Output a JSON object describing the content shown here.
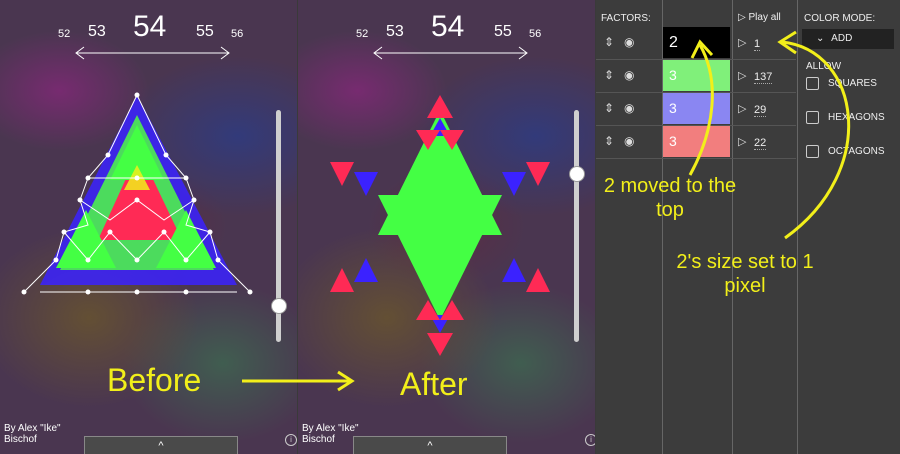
{
  "before_panel": {
    "numbers": {
      "n52": "52",
      "n53": "53",
      "n54": "54",
      "n55": "55",
      "n56": "56"
    },
    "credit": "By Alex \"Ike\" Bischof",
    "tab_icon": "^",
    "info_icon": "i",
    "slider_value": 0.16
  },
  "after_panel": {
    "numbers": {
      "n52": "52",
      "n53": "53",
      "n54": "54",
      "n55": "55",
      "n56": "56"
    },
    "credit": "By Alex \"Ike\" Bischof",
    "tab_icon": "^",
    "info_icon": "i",
    "slider_value": 0.73
  },
  "labels": {
    "before": "Before",
    "after": "After"
  },
  "annotations": {
    "moved": "2 moved to the top",
    "size": "2's size set to 1 pixel"
  },
  "factors": {
    "header": "FACTORS:",
    "play_all": "Play all",
    "rows": [
      {
        "value": "2",
        "size": "1",
        "color": "#000000"
      },
      {
        "value": "3",
        "size": "137",
        "color": "#80f07a"
      },
      {
        "value": "3",
        "size": "29",
        "color": "#8a86f2"
      },
      {
        "value": "3",
        "size": "22",
        "color": "#f27e7e"
      }
    ]
  },
  "color_mode": {
    "header": "COLOR MODE:",
    "selected": "ADD",
    "allow_label": "ALLOW",
    "options": [
      "SQUARES",
      "HEXAGONS",
      "OCTAGONS"
    ]
  },
  "colors": {
    "annotation": "#f2ef1a",
    "red": "#ff2a55",
    "green": "#44ff44",
    "blue": "#3322ff"
  }
}
